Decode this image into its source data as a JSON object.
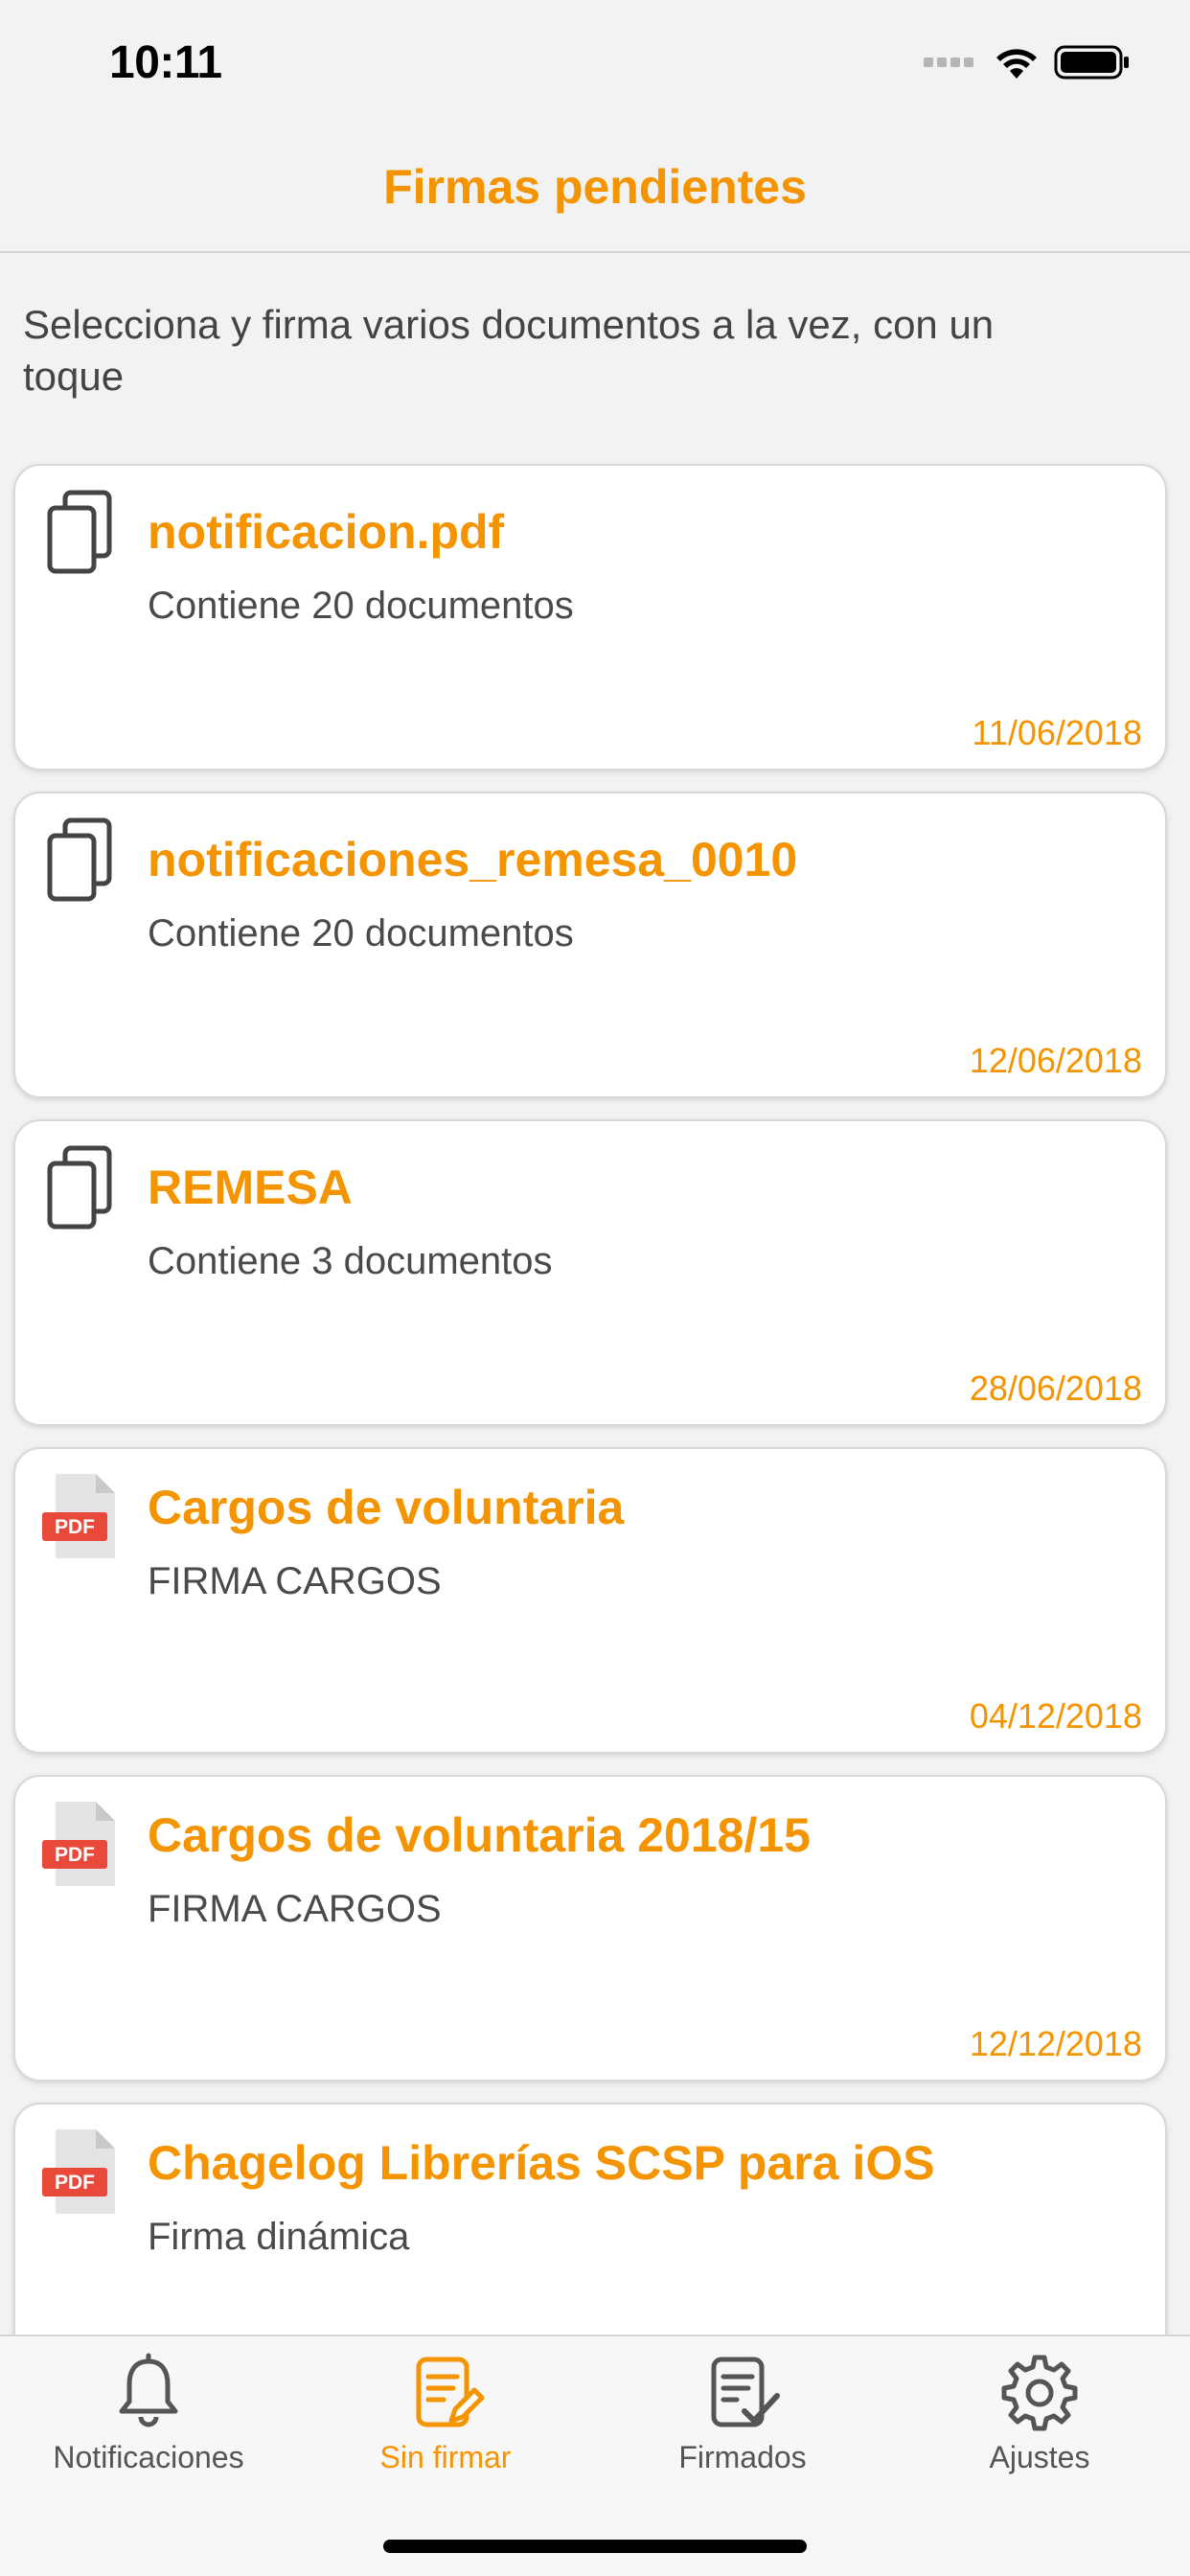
{
  "status_bar": {
    "time": "10:11"
  },
  "nav": {
    "title": "Firmas pendientes"
  },
  "intro_text": "Selecciona y firma varios documentos a la vez, con un toque",
  "documents": [
    {
      "icon": "multi-document-icon",
      "title": "notificacion.pdf",
      "subtitle": "Contiene 20 documentos",
      "date": "11/06/2018"
    },
    {
      "icon": "multi-document-icon",
      "title": "notificaciones_remesa_0010",
      "subtitle": "Contiene 20 documentos",
      "date": "12/06/2018"
    },
    {
      "icon": "multi-document-icon",
      "title": "REMESA",
      "subtitle": "Contiene 3 documentos",
      "date": "28/06/2018"
    },
    {
      "icon": "pdf-file-icon",
      "title": "Cargos de voluntaria",
      "subtitle": "FIRMA CARGOS",
      "date": "04/12/2018"
    },
    {
      "icon": "pdf-file-icon",
      "title": "Cargos de voluntaria 2018/15",
      "subtitle": "FIRMA CARGOS",
      "date": "12/12/2018"
    },
    {
      "icon": "pdf-file-icon",
      "title": "Chagelog Librerías SCSP para iOS",
      "subtitle": "Firma dinámica",
      "date": ""
    }
  ],
  "pdf_badge_text": "PDF",
  "tabs": [
    {
      "label": "Notificaciones",
      "icon": "bell-icon",
      "active": false
    },
    {
      "label": "Sin firmar",
      "icon": "edit-document-icon",
      "active": true
    },
    {
      "label": "Firmados",
      "icon": "signed-document-icon",
      "active": false
    },
    {
      "label": "Ajustes",
      "icon": "gear-icon",
      "active": false
    }
  ],
  "colors": {
    "accent": "#f39400",
    "background": "#f2f2f2",
    "card": "#ffffff",
    "text": "#4a4a4a",
    "pdf_badge": "#e8493a"
  }
}
